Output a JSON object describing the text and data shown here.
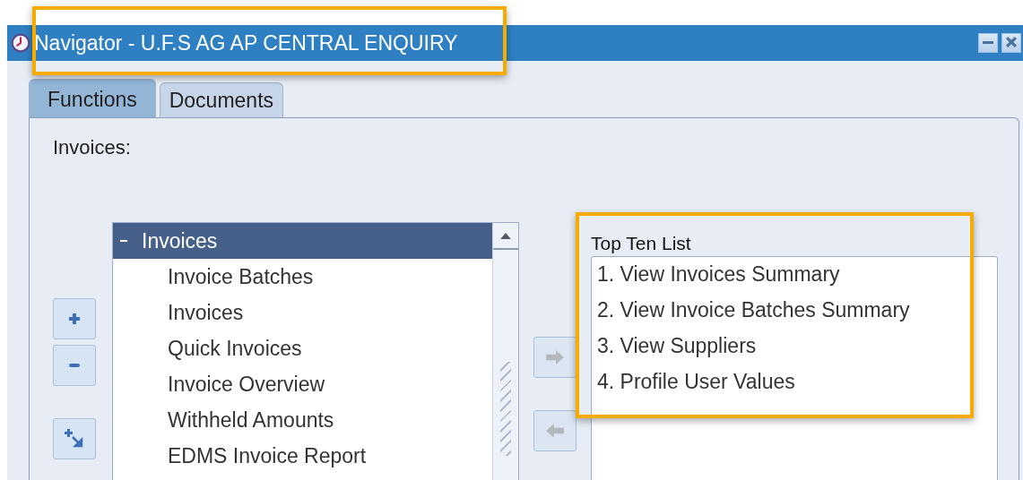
{
  "window": {
    "title": "Navigator - U.F.S AG AP CENTRAL ENQUIRY"
  },
  "tabs": [
    {
      "label": "Functions",
      "selected": true
    },
    {
      "label": "Documents",
      "selected": false
    }
  ],
  "section_label": "Invoices:",
  "tree": [
    {
      "label": "Invoices",
      "expanded": true,
      "selected": true,
      "children": [
        {
          "label": "Invoice Batches",
          "selected": false
        },
        {
          "label": "Invoices",
          "selected": false
        },
        {
          "label": "Quick Invoices",
          "selected": false
        },
        {
          "label": "Invoice Overview",
          "selected": false
        },
        {
          "label": "Withheld Amounts",
          "selected": false
        },
        {
          "label": "EDMS Invoice Report",
          "selected": false
        }
      ]
    }
  ],
  "tree_buttons": [
    {
      "kind": "expand"
    },
    {
      "kind": "collapse"
    },
    {
      "kind": "expand_all"
    }
  ],
  "transfer_buttons": [
    {
      "kind": "add",
      "disabled": true
    },
    {
      "kind": "remove",
      "disabled": true
    }
  ],
  "top_ten": {
    "label": "Top Ten List",
    "items": [
      "1. View Invoices Summary",
      "2. View Invoice Batches Summary",
      "3. View Suppliers",
      "4. Profile User Values"
    ]
  }
}
